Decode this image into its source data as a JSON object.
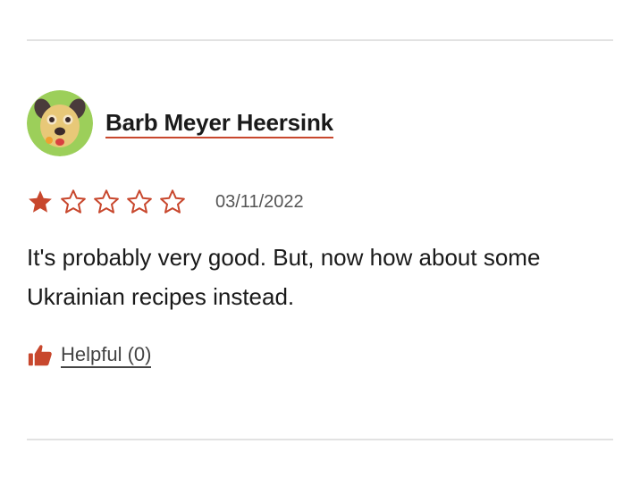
{
  "review": {
    "author": {
      "name": "Barb Meyer Heersink",
      "avatar_icon": "dog-face-avatar-icon"
    },
    "rating": {
      "value": 1,
      "max": 5,
      "filled_icon": "star-filled-icon",
      "empty_icon": "star-outline-icon",
      "color": "#c8472d"
    },
    "date": "03/11/2022",
    "text": "It's probably very good. But, now how about some Ukrainian recipes instead.",
    "helpful": {
      "label": "Helpful (0)",
      "icon": "thumbs-up-icon",
      "icon_color": "#c8472d"
    }
  },
  "colors": {
    "accent": "#c8472d",
    "divider": "#e2e2e2",
    "text": "#1a1a1a",
    "muted": "#555555"
  }
}
